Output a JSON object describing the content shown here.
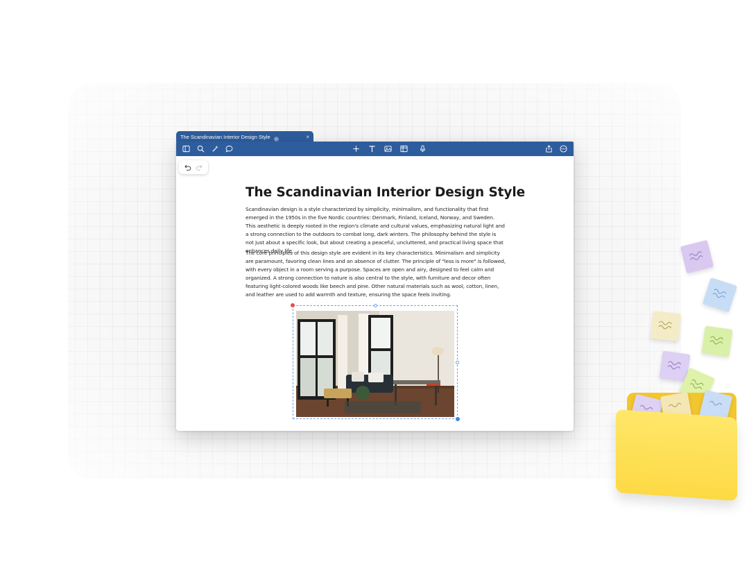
{
  "tab": {
    "title": "The Scandinavian Interior Design Style",
    "close_glyph": "×",
    "chevron_glyph": "⌄"
  },
  "toolbar": {
    "left_icons": [
      "sidebar-icon",
      "search-icon",
      "magic-icon",
      "comment-icon"
    ],
    "center_icons": [
      "add-icon",
      "text-icon",
      "image-icon",
      "table-icon",
      "microphone-icon"
    ],
    "right_icons": [
      "share-icon",
      "more-icon"
    ]
  },
  "document": {
    "title": "The Scandinavian Interior Design Style",
    "paragraphs": [
      "Scandinavian design is a style characterized by simplicity, minimalism, and functionality that first emerged in the 1950s in the five Nordic countries: Denmark, Finland, Iceland, Norway, and Sweden. This aesthetic is deeply rooted in the region's climate and cultural values, emphasizing natural light and a strong connection to the outdoors to combat long, dark winters. The philosophy behind the style is not just about a specific look, but about creating a peaceful, uncluttered, and practical living space that enhances daily life.",
      "The core principles of this design style are evident in its key characteristics. Minimalism and simplicity are paramount, favoring clean lines and an absence of clutter. The principle of \"less is more\" is followed, with every object in a room serving a purpose. Spaces are open and airy, designed to feel calm and organized. A strong connection to nature is also central to the style, with furniture and decor often featuring light-colored woods like beech and pine. Other natural materials such as wool, cotton, linen, and leather are used to add warmth and texture, ensuring the space feels inviting."
    ]
  },
  "colors": {
    "toolbar": "#2e5d9d",
    "selection": "#6fa2e6",
    "folder": "#fdd944"
  }
}
